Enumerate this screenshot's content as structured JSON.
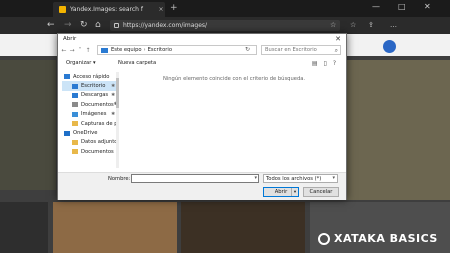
{
  "browser": {
    "tab_title": "Yandex.Images: search f",
    "tab_close": "×",
    "new_tab": "+",
    "window_controls": {
      "minimize": "—",
      "maximize": "□",
      "close": "✕"
    },
    "nav": {
      "back": "←",
      "forward": "→",
      "reload": "↻",
      "home": "⌂"
    },
    "url": "https://yandex.com/images/",
    "icons": [
      "star-icon",
      "favorites-icon",
      "share-icon",
      "more-icon"
    ],
    "icon_glyphs": {
      "star": "☆",
      "favorites": "☆",
      "share": "⇪",
      "more": "…"
    }
  },
  "dialog": {
    "title": "Abrir",
    "close": "✕",
    "nav_arrows": {
      "back": "←",
      "forward": "→",
      "down": "˅",
      "up": "↑"
    },
    "breadcrumb": [
      "Este equipo",
      "Escritorio"
    ],
    "breadcrumb_sep": "›",
    "search_placeholder": "Buscar en Escritorio",
    "commands": {
      "organize": "Organizar ▾",
      "new_folder": "Nueva carpeta"
    },
    "nav_items": [
      {
        "label": "Acceso rápido",
        "type": "header",
        "icon": "star-icon",
        "color": "#2a7ad2"
      },
      {
        "label": "Escritorio",
        "type": "sub",
        "icon": "desktop-icon",
        "color": "#2a7ad2",
        "selected": true,
        "pinned": true
      },
      {
        "label": "Descargas",
        "type": "sub",
        "icon": "download-icon",
        "color": "#2a7ad2",
        "pinned": true
      },
      {
        "label": "Documentos",
        "type": "sub",
        "icon": "documents-icon",
        "color": "#8a8a8a",
        "pinned": true
      },
      {
        "label": "Imágenes",
        "type": "sub",
        "icon": "pictures-icon",
        "color": "#3a8fd8",
        "pinned": true
      },
      {
        "label": "Capturas de p",
        "type": "sub",
        "icon": "folder-icon",
        "color": "#e8b84a"
      },
      {
        "label": "OneDrive",
        "type": "header",
        "icon": "cloud-icon",
        "color": "#1e6fc8"
      },
      {
        "label": "Datos adjuntos c",
        "type": "sub",
        "icon": "folder-icon",
        "color": "#e8b84a"
      },
      {
        "label": "Documentos",
        "type": "sub",
        "icon": "folder-icon",
        "color": "#e8b84a"
      }
    ],
    "pin_glyph": "✱",
    "empty_message": "Ningún elemento coincide con el criterio de búsqueda.",
    "filename_label": "Nombre:",
    "filename_value": "",
    "filetype": "Todos los archivos (*)",
    "open_button": "Abrir",
    "cancel_button": "Cancelar",
    "dropdown_glyph": "▾"
  },
  "watermark": "XATAKA BASICS"
}
